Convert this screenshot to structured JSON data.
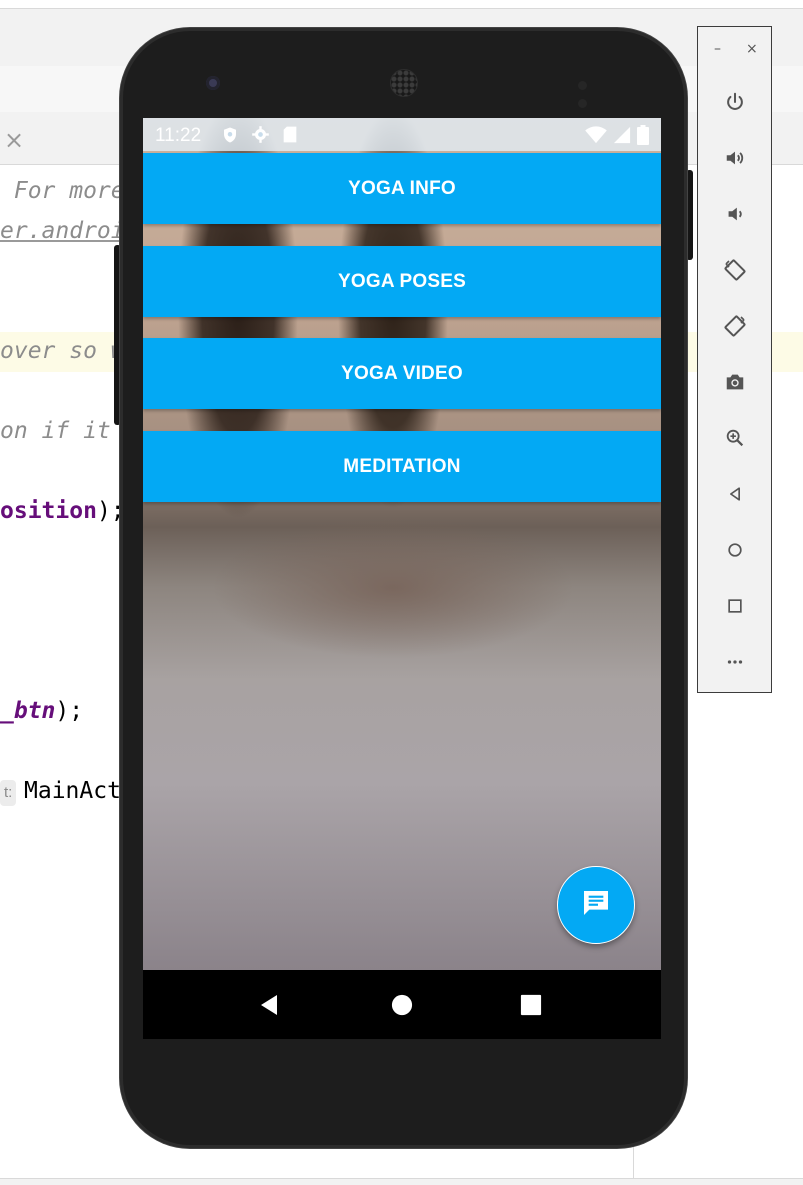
{
  "ide": {
    "close_symbol": "×",
    "code": {
      "line1": " For more",
      "line2": "er.androic",
      "line3": "over so w",
      "line4": "on if it r",
      "line5_ident": "osition",
      "line5_rest": ");",
      "line6_ident": "_btn",
      "line6_rest": ");",
      "chip": "t:",
      "line7": "MainAct"
    }
  },
  "emulator_controls": {
    "minimize": "–",
    "close": "×",
    "buttons": [
      "power-icon",
      "volume-up-icon",
      "volume-down-icon",
      "rotate-left-icon",
      "rotate-right-icon",
      "camera-icon",
      "zoom-in-icon",
      "back-icon",
      "home-icon",
      "overview-icon",
      "more-icon"
    ]
  },
  "status_bar": {
    "time": "11:22"
  },
  "menu": {
    "items": [
      {
        "label": "YOGA INFO"
      },
      {
        "label": "YOGA POSES"
      },
      {
        "label": "YOGA VIDEO"
      },
      {
        "label": "MEDITATION"
      }
    ]
  },
  "colors": {
    "accent": "#03a9f4",
    "navbar": "#000000",
    "phone_body": "#1d1d1d"
  },
  "fab": {
    "icon": "chat-icon"
  },
  "nav_bar": {
    "buttons": [
      "back-icon",
      "home-icon",
      "recents-icon"
    ]
  }
}
